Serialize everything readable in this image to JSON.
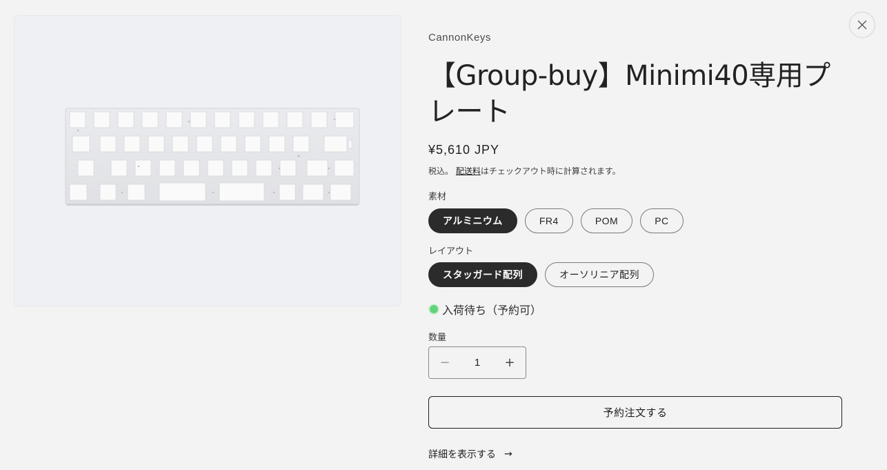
{
  "product": {
    "vendor": "CannonKeys",
    "title": "【Group-buy】Minimi40専用プレート",
    "price": "¥5,610 JPY",
    "tax_prefix": "税込。",
    "shipping_link": "配送料",
    "tax_suffix": "はチェックアウト時に計算されます。",
    "material": {
      "label": "素材",
      "options": [
        "アルミニウム",
        "FR4",
        "POM",
        "PC"
      ],
      "selected": "アルミニウム"
    },
    "layout": {
      "label": "レイアウト",
      "options": [
        "スタッガード配列",
        "オーソリニア配列"
      ],
      "selected": "スタッガード配列"
    },
    "stock_status": "入荷待ち（予約可）",
    "quantity": {
      "label": "数量",
      "value": "1",
      "minus": "−",
      "plus": "+"
    },
    "reserve_button": "予約注文する",
    "details_link": "詳細を表示する",
    "details_arrow": "→"
  },
  "icons": {
    "close": "close-icon",
    "arrow": "arrow-right-icon",
    "status_dot": "status-dot-icon"
  },
  "colors": {
    "background": "#f3f3f3",
    "selected_pill": "#2b2b2b",
    "stock_dot": "#62d37a",
    "media_bg": "#eef0f3"
  }
}
